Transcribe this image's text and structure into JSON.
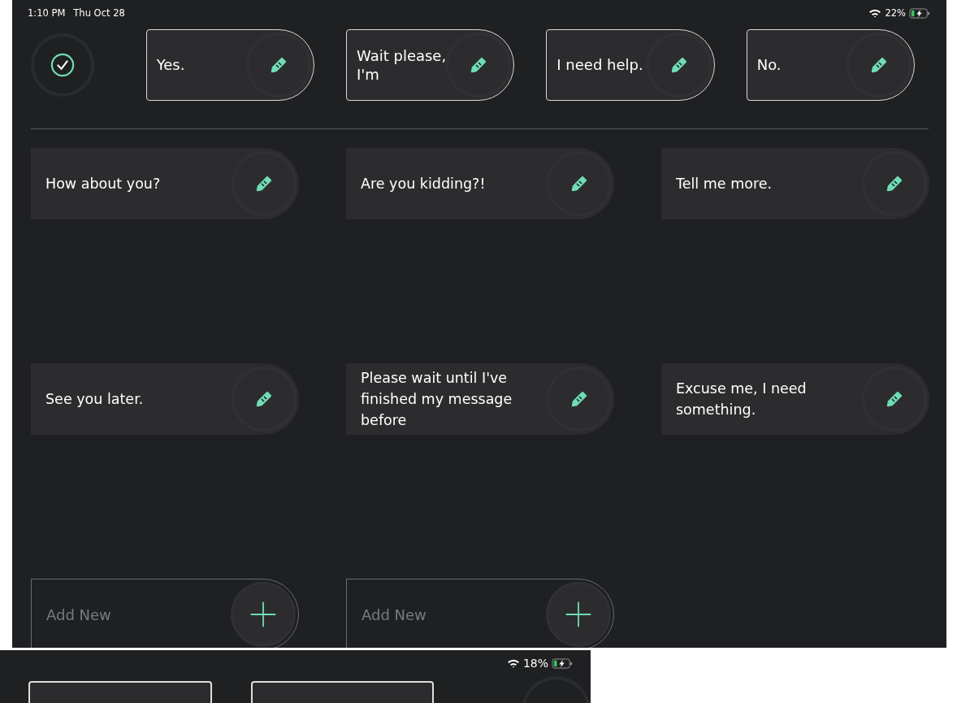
{
  "status_bar": {
    "time": "1:10 PM",
    "date": "Thu Oct 28",
    "battery": "22%"
  },
  "quick_phrases": [
    {
      "text": "Yes."
    },
    {
      "text": "Wait please, I'm"
    },
    {
      "text": "I need help."
    },
    {
      "text": "No."
    }
  ],
  "tiles": [
    {
      "kind": "phrase",
      "text": "How about you?"
    },
    {
      "kind": "phrase",
      "text": "Are you kidding?!"
    },
    {
      "kind": "phrase",
      "text": "Tell me more."
    },
    {
      "kind": "phrase",
      "text": "See you later."
    },
    {
      "kind": "phrase",
      "text": "Please wait until I've finished my message before"
    },
    {
      "kind": "phrase",
      "text": "Excuse me, I need something."
    },
    {
      "kind": "add",
      "placeholder": "Add New"
    },
    {
      "kind": "add",
      "placeholder": "Add New"
    }
  ],
  "second_screen": {
    "battery": "18%"
  }
}
